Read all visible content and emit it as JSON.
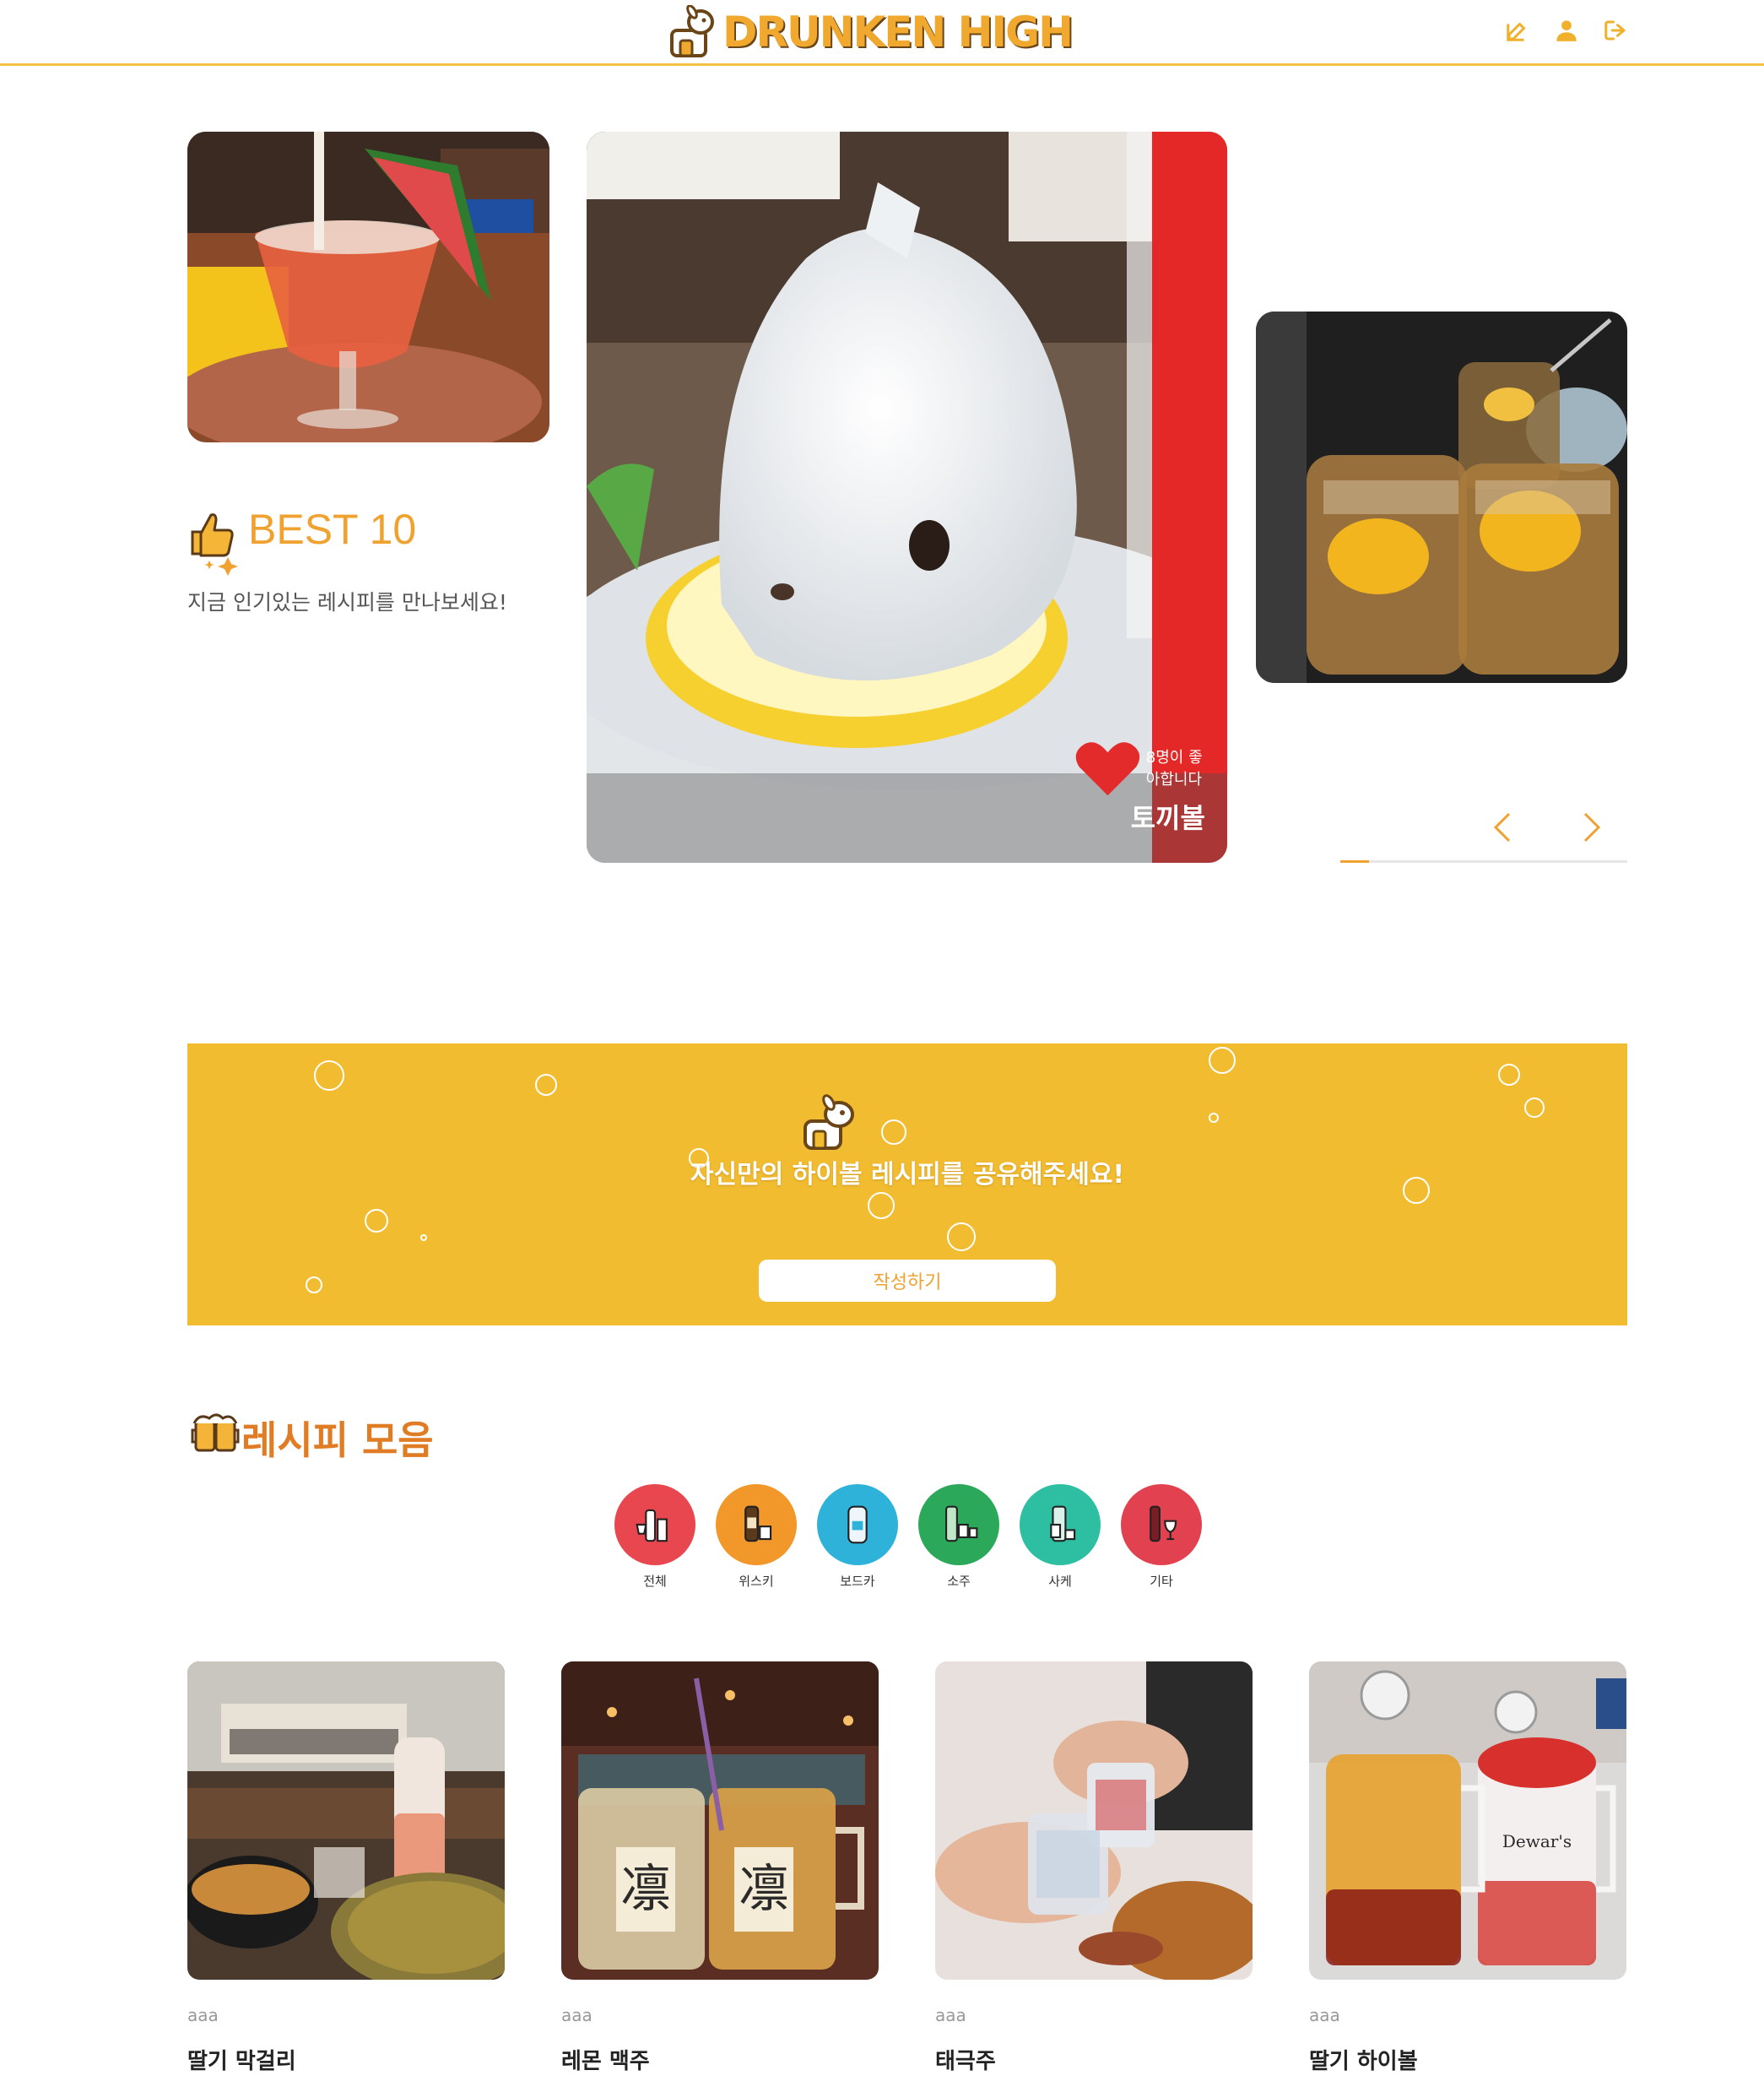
{
  "header": {
    "logo_text": "DRUNKEN HIGH",
    "icons": [
      "edit-icon",
      "user-icon",
      "logout-icon"
    ],
    "accent_color": "#f4c243"
  },
  "best": {
    "title": "BEST 10",
    "subtitle": "지금 인기있는 레시피를 만나보세요!",
    "main_slide": {
      "likes": "8명이 좋아합니다",
      "title": "토끼볼"
    },
    "progress": 0.1,
    "accent_color": "#f0a231"
  },
  "banner": {
    "text": "자신만의 하이볼 레시피를 공유해주세요!",
    "button": "작성하기",
    "bg_color": "#f1bc30"
  },
  "recipes": {
    "title": "레시피 모음",
    "categories": [
      {
        "label": "전체",
        "color": "#e8474f",
        "icon": "bottles-icon"
      },
      {
        "label": "위스키",
        "color": "#f2982b",
        "icon": "whisky-icon"
      },
      {
        "label": "보드카",
        "color": "#2fb2d9",
        "icon": "vodka-icon"
      },
      {
        "label": "소주",
        "color": "#2ca85a",
        "icon": "soju-icon"
      },
      {
        "label": "사케",
        "color": "#2ebfa2",
        "icon": "sake-icon"
      },
      {
        "label": "기타",
        "color": "#e2424f",
        "icon": "wine-icon"
      }
    ],
    "cards": [
      {
        "author": "aaa",
        "title": "딸기 막걸리"
      },
      {
        "author": "aaa",
        "title": "레몬 맥주"
      },
      {
        "author": "aaa",
        "title": "태극주"
      },
      {
        "author": "aaa",
        "title": "딸기 하이볼"
      }
    ]
  }
}
